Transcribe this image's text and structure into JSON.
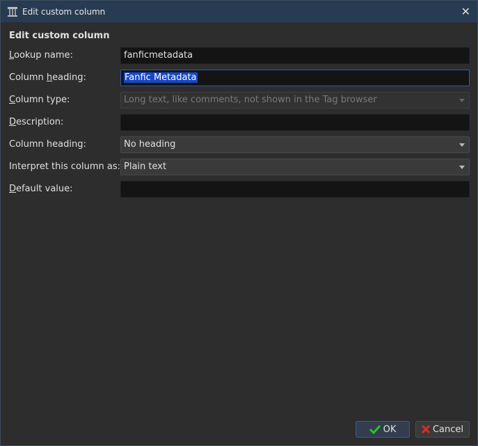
{
  "window": {
    "title": "Edit custom column"
  },
  "heading": "Edit custom column",
  "fields": [
    {
      "label_u": "L",
      "label_rest": "ookup name:",
      "value": "fanficmetadata"
    },
    {
      "label_pre": "Column ",
      "label_u": "h",
      "label_rest": "eading:",
      "value": "Fanfic Metadata"
    },
    {
      "label_u": "C",
      "label_rest": "olumn type:",
      "value": "Long text, like comments, not shown in the Tag browser"
    },
    {
      "label_u": "D",
      "label_rest": "escription:",
      "value": ""
    },
    {
      "label": "Column heading:",
      "value": "No heading"
    },
    {
      "label": "Interpret this column as:",
      "value": "Plain text"
    },
    {
      "label_u": "D",
      "label_rest": "efault value:",
      "value": ""
    }
  ],
  "buttons": {
    "ok": "OK",
    "cancel": "Cancel"
  },
  "colors": {
    "titlebar": "#273c52",
    "focus": "#2f5bb8",
    "ok_check": "#2ec22e",
    "cancel_x": "#d92b2b"
  }
}
